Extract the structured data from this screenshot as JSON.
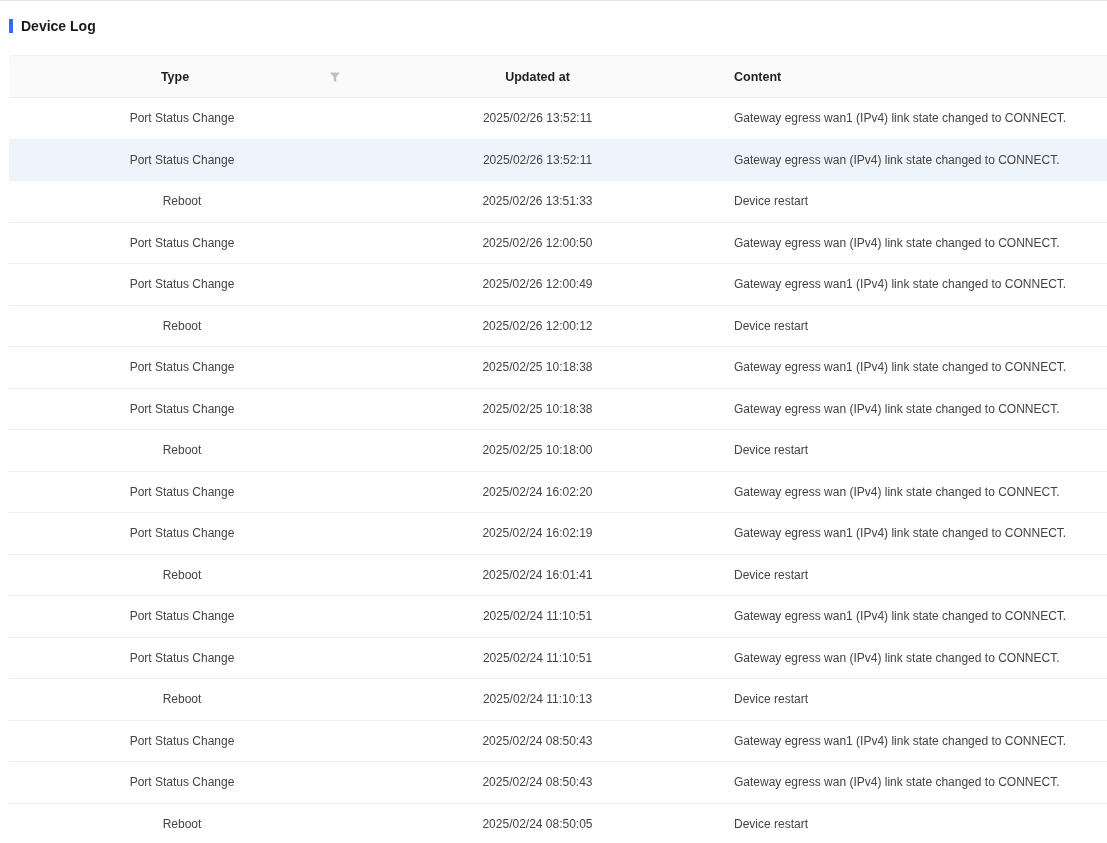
{
  "title": "Device Log",
  "table": {
    "columns": [
      {
        "label": "Type",
        "filter": true
      },
      {
        "label": "Updated at",
        "filter": false
      },
      {
        "label": "Content",
        "filter": false
      }
    ],
    "rows": [
      {
        "type": "Port Status Change",
        "updated_at": "2025/02/26 13:52:11",
        "content": "Gateway egress wan1 (IPv4) link state changed to CONNECT.",
        "highlighted": false
      },
      {
        "type": "Port Status Change",
        "updated_at": "2025/02/26 13:52:11",
        "content": "Gateway egress wan (IPv4) link state changed to CONNECT.",
        "highlighted": true
      },
      {
        "type": "Reboot",
        "updated_at": "2025/02/26 13:51:33",
        "content": "Device restart",
        "highlighted": false
      },
      {
        "type": "Port Status Change",
        "updated_at": "2025/02/26 12:00:50",
        "content": "Gateway egress wan (IPv4) link state changed to CONNECT.",
        "highlighted": false
      },
      {
        "type": "Port Status Change",
        "updated_at": "2025/02/26 12:00:49",
        "content": "Gateway egress wan1 (IPv4) link state changed to CONNECT.",
        "highlighted": false
      },
      {
        "type": "Reboot",
        "updated_at": "2025/02/26 12:00:12",
        "content": "Device restart",
        "highlighted": false
      },
      {
        "type": "Port Status Change",
        "updated_at": "2025/02/25 10:18:38",
        "content": "Gateway egress wan1 (IPv4) link state changed to CONNECT.",
        "highlighted": false
      },
      {
        "type": "Port Status Change",
        "updated_at": "2025/02/25 10:18:38",
        "content": "Gateway egress wan (IPv4) link state changed to CONNECT.",
        "highlighted": false
      },
      {
        "type": "Reboot",
        "updated_at": "2025/02/25 10:18:00",
        "content": "Device restart",
        "highlighted": false
      },
      {
        "type": "Port Status Change",
        "updated_at": "2025/02/24 16:02:20",
        "content": "Gateway egress wan (IPv4) link state changed to CONNECT.",
        "highlighted": false
      },
      {
        "type": "Port Status Change",
        "updated_at": "2025/02/24 16:02:19",
        "content": "Gateway egress wan1 (IPv4) link state changed to CONNECT.",
        "highlighted": false
      },
      {
        "type": "Reboot",
        "updated_at": "2025/02/24 16:01:41",
        "content": "Device restart",
        "highlighted": false
      },
      {
        "type": "Port Status Change",
        "updated_at": "2025/02/24 11:10:51",
        "content": "Gateway egress wan1 (IPv4) link state changed to CONNECT.",
        "highlighted": false
      },
      {
        "type": "Port Status Change",
        "updated_at": "2025/02/24 11:10:51",
        "content": "Gateway egress wan (IPv4) link state changed to CONNECT.",
        "highlighted": false
      },
      {
        "type": "Reboot",
        "updated_at": "2025/02/24 11:10:13",
        "content": "Device restart",
        "highlighted": false
      },
      {
        "type": "Port Status Change",
        "updated_at": "2025/02/24 08:50:43",
        "content": "Gateway egress wan1 (IPv4) link state changed to CONNECT.",
        "highlighted": false
      },
      {
        "type": "Port Status Change",
        "updated_at": "2025/02/24 08:50:43",
        "content": "Gateway egress wan (IPv4) link state changed to CONNECT.",
        "highlighted": false
      },
      {
        "type": "Reboot",
        "updated_at": "2025/02/24 08:50:05",
        "content": "Device restart",
        "highlighted": false
      }
    ]
  }
}
